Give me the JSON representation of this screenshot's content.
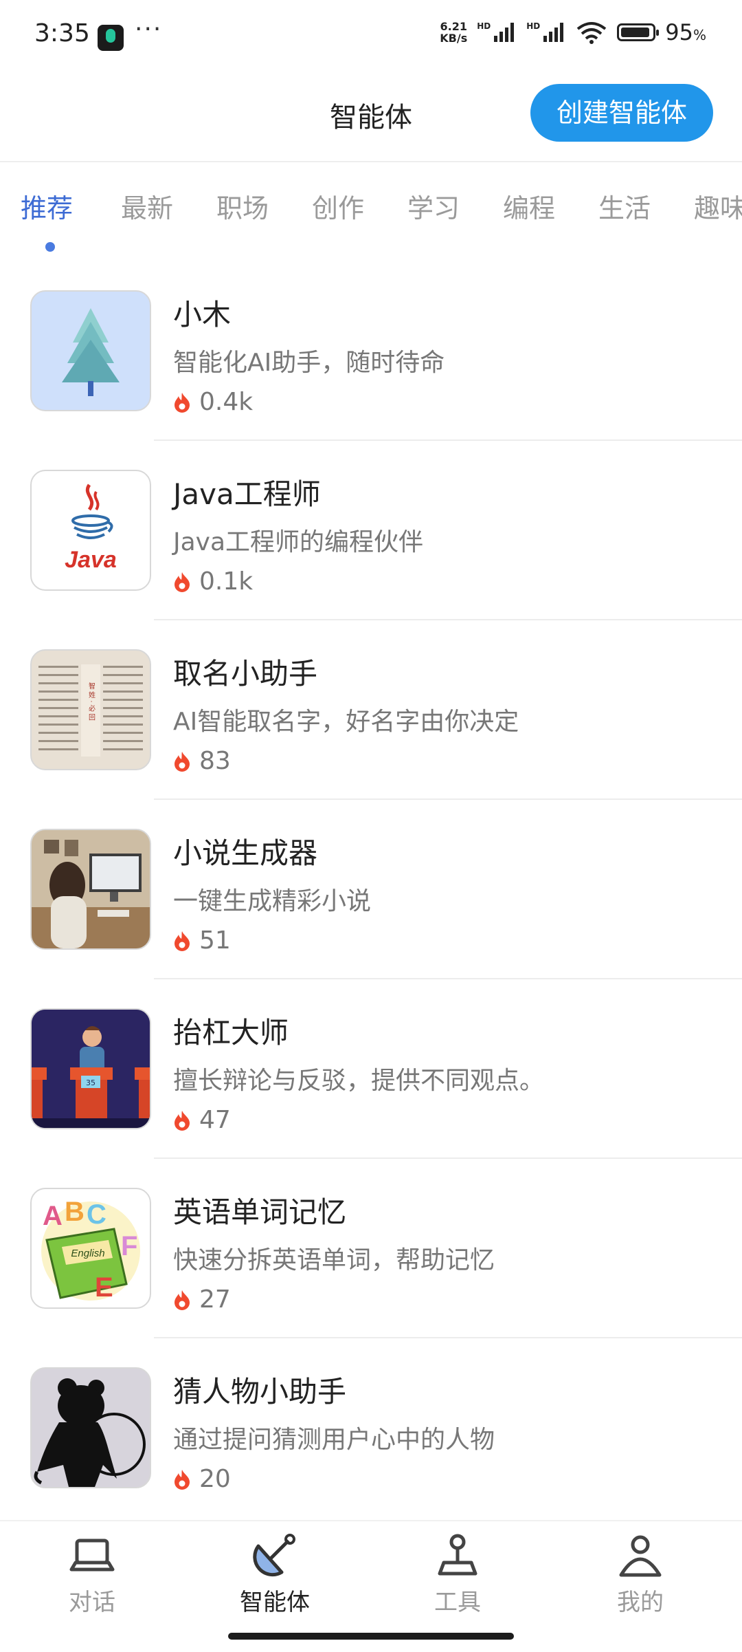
{
  "status_bar": {
    "time": "3:35",
    "dots": "···",
    "net_speed_value": "6.21",
    "net_speed_unit": "KB/s",
    "hd1": "HD",
    "hd2": "HD",
    "battery_pct": "95",
    "battery_unit": "%"
  },
  "header": {
    "title": "智能体",
    "create_button": "创建智能体"
  },
  "tabs": [
    {
      "label": "推荐",
      "active": true
    },
    {
      "label": "最新"
    },
    {
      "label": "职场"
    },
    {
      "label": "创作"
    },
    {
      "label": "学习"
    },
    {
      "label": "编程"
    },
    {
      "label": "生活"
    },
    {
      "label": "趣味"
    }
  ],
  "items": [
    {
      "name": "小木",
      "desc": "智能化AI助手，随时待命",
      "count": "0.4k",
      "icon": "tree-icon"
    },
    {
      "name": "Java工程师",
      "desc": "Java工程师的编程伙伴",
      "count": "0.1k",
      "icon": "java-logo-icon",
      "logo_text": "Java"
    },
    {
      "name": "取名小助手",
      "desc": "AI智能取名字，好名字由你决定",
      "count": "83",
      "icon": "naming-scroll-icon",
      "logo_text": "智 姓 · 必 回"
    },
    {
      "name": "小说生成器",
      "desc": "一键生成精彩小说",
      "count": "51",
      "icon": "writer-desk-icon"
    },
    {
      "name": "抬杠大师",
      "desc": "擅长辩论与反驳，提供不同观点。",
      "count": "47",
      "icon": "debate-stage-icon",
      "logo_text": "35"
    },
    {
      "name": "英语单词记忆",
      "desc": "快速分拆英语单词，帮助记忆",
      "count": "27",
      "icon": "english-book-icon",
      "logo_text": "English"
    },
    {
      "name": "猜人物小助手",
      "desc": "通过提问猜测用户心中的人物",
      "count": "20",
      "icon": "silhouette-icon"
    }
  ],
  "bottom_nav": [
    {
      "label": "对话",
      "icon": "laptop-icon"
    },
    {
      "label": "智能体",
      "icon": "satellite-dish-icon",
      "active": true
    },
    {
      "label": "工具",
      "icon": "joystick-icon"
    },
    {
      "label": "我的",
      "icon": "person-icon"
    }
  ],
  "colors": {
    "accent": "#2196ea",
    "tab_active": "#3d6bd4",
    "fire": "#f0492e"
  }
}
